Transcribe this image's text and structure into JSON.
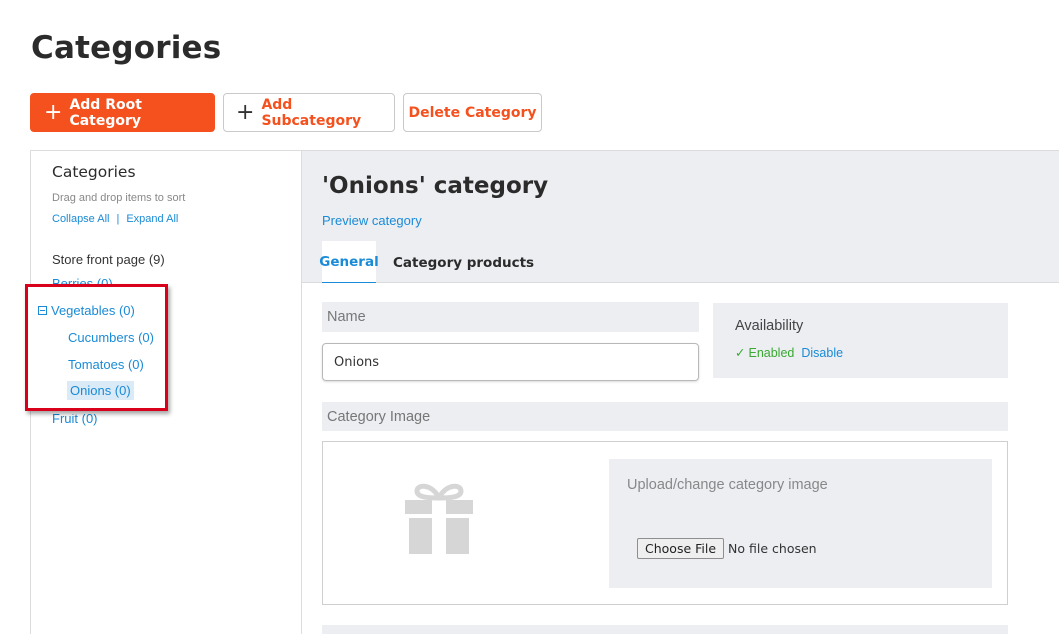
{
  "page": {
    "title": "Categories"
  },
  "toolbar": {
    "add_root_label": "Add Root Category",
    "add_sub_label": "Add Subcategory",
    "delete_label": "Delete Category"
  },
  "tree_panel": {
    "title": "Categories",
    "hint": "Drag and drop items to sort",
    "collapse_all": "Collapse All",
    "separator": "|",
    "expand_all": "Expand All",
    "root": "Store front page (9)",
    "items": [
      {
        "label": "Berries (0)",
        "level": 0
      },
      {
        "label": "Vegetables (0)",
        "level": 0,
        "expanded": true
      },
      {
        "label": "Cucumbers (0)",
        "level": 1
      },
      {
        "label": "Tomatoes (0)",
        "level": 1
      },
      {
        "label": "Onions (0)",
        "level": 1,
        "selected": true
      },
      {
        "label": "Fruit (0)",
        "level": 0
      }
    ]
  },
  "editor": {
    "title": "'Onions' category",
    "preview_link": "Preview category",
    "tabs": [
      {
        "label": "General",
        "active": true
      },
      {
        "label": "Category products",
        "active": false
      }
    ],
    "name_label": "Name",
    "name_value": "Onions",
    "availability_label": "Availability",
    "enabled_label": "Enabled",
    "disable_link": "Disable",
    "image_label": "Category Image",
    "upload_label": "Upload/change category image",
    "choose_file_label": "Choose File",
    "no_file_label": "No file chosen"
  },
  "colors": {
    "accent": "#f4511e",
    "link": "#1a8bd6",
    "success": "#3aa832",
    "highlight_box": "#d8001b",
    "panel_bg": "#eceef2"
  },
  "icons": [
    "plus-icon",
    "minus-box-icon",
    "check-icon",
    "gift-icon"
  ]
}
